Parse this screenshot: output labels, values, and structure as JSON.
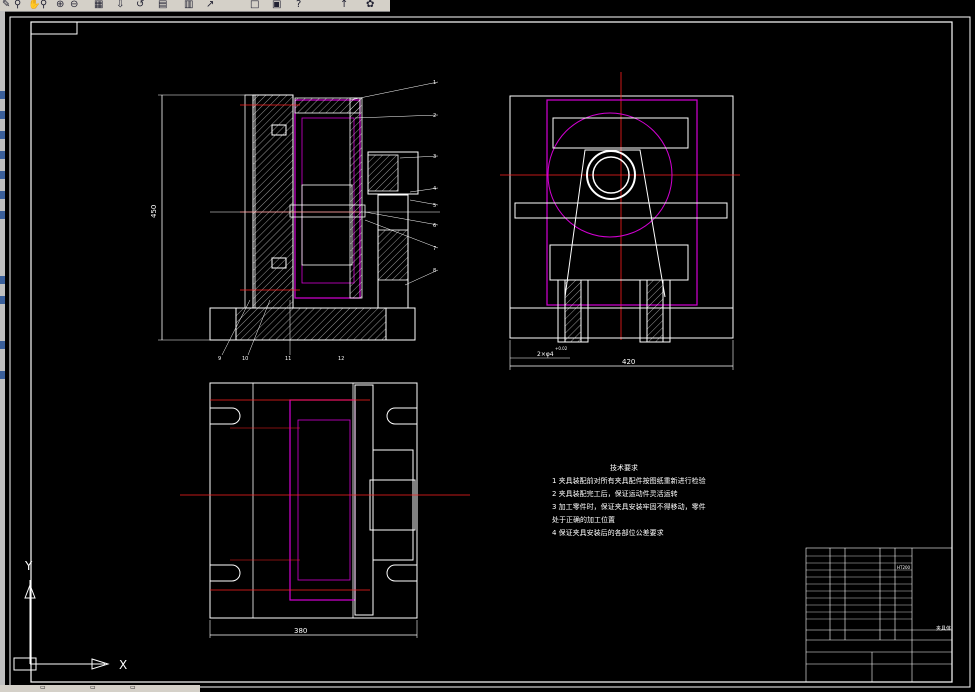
{
  "toolbar": {
    "icons": [
      "pencil-icon",
      "match-properties-icon",
      "pan-icon",
      "zoom-realtime-icon",
      "zoom-previous-icon",
      "properties-icon",
      "designcenter-icon",
      "undo-icon",
      "copy-icon",
      "save-icon",
      "redo-icon",
      "help-icon",
      "paint-icon"
    ]
  },
  "dimensions": {
    "height_side_view": "450",
    "width_top_view": "380",
    "width_right_view": "420",
    "fit_note": "2×φ4",
    "fit_note_sup": "+0.02"
  },
  "balloons": [
    "1",
    "2",
    "3",
    "4",
    "5",
    "6",
    "7",
    "8",
    "9",
    "10",
    "11",
    "12"
  ],
  "tech_requirements": {
    "title": "技术要求",
    "items": [
      "1   夹具装配前对所有夹具配件按图纸重新进行检验",
      "2   夹具装配完工后，保证运动件灵活运转",
      "3   加工零件时，保证夹具安装牢固不得移动，零件",
      "      处于正确的加工位置",
      "4   保证夹具安装后的各部位公差要求"
    ]
  },
  "title_block": {
    "material": "HT200",
    "title_code": "夹具体"
  },
  "colors": {
    "background": "#000000",
    "outline": "#ffffff",
    "center_line": "#ff2020",
    "part_line": "#d400d4"
  },
  "ucs": {
    "x_label": "X",
    "y_label": "Y"
  }
}
